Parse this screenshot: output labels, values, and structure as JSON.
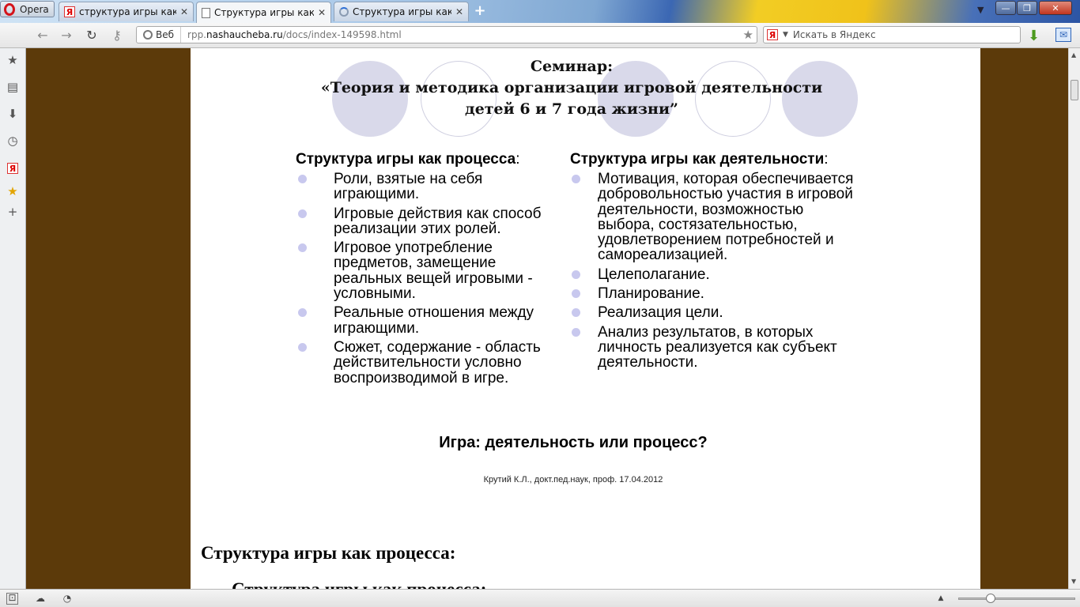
{
  "browser": {
    "menu_label": "Opera",
    "tabs": [
      {
        "label": "структура игры как пр...",
        "close": "✕"
      },
      {
        "label": "Структура игры как п...",
        "close": "✕"
      },
      {
        "label": "Структура игры как п...",
        "close": "✕"
      }
    ],
    "new_tab": "+",
    "window_controls": {
      "minimize": "—",
      "restore": "❐",
      "close": "✕"
    }
  },
  "navbar": {
    "web_label": "Веб",
    "url_prefix": "rpp.",
    "url_domain": "nashaucheba.ru",
    "url_path": "/docs/index-149598.html",
    "search_engine": "Я",
    "search_placeholder": "Искать в Яндекс"
  },
  "slide": {
    "title_line1": "Семинар:",
    "title_line2": "«Теория и методика организации игровой деятельности",
    "title_line3": "детей 6 и 7 года жизни”",
    "left": {
      "heading": "Структура игры как процесса",
      "heading_suffix": ":",
      "items": [
        "Роли, взятые на себя играющими.",
        "Игровые действия как способ реализации этих ролей.",
        "Игровое употребление предметов, замещение реальных вещей игровыми - условными.",
        "Реальные отношения между играющими.",
        "Сюжет, содержание - область действительности условно воспроизводимой в игре."
      ]
    },
    "right": {
      "heading": "Структура игры как деятельности",
      "heading_suffix": ":",
      "items": [
        "Мотивация, которая обеспечивается добровольностью участия в игровой деятельности, возможностью выбора, состязательностью, удовлетворением потребностей и самореализацией.",
        "Целеполагание.",
        "Планирование.",
        "Реализация цели.",
        "Анализ результатов, в которых личность реализуется как субъект деятельности."
      ]
    },
    "question": "Игра: деятельность или процесс?",
    "footer": "Крутий К.Л., докт.пед.наук, проф. 17.04.2012"
  },
  "document": {
    "heading": "Структура игры как процесса:",
    "heading2": "Структура игры как процесса:"
  }
}
